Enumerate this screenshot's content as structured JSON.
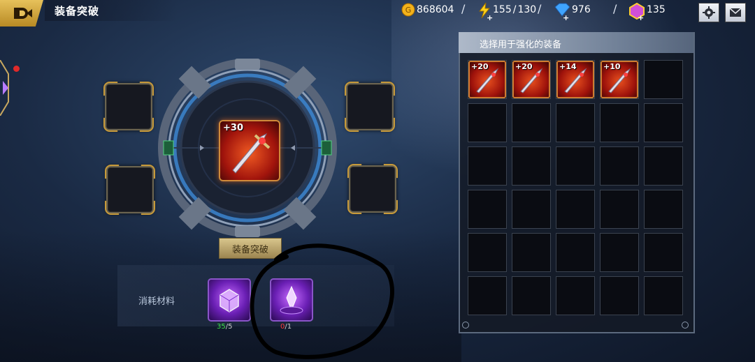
{
  "header": {
    "title": "装备突破"
  },
  "resources": {
    "gold": "868604",
    "energy": "155",
    "energy_max": "130",
    "diamond": "976",
    "gem": "135",
    "slash": "/"
  },
  "forge": {
    "center_item_level": "+30",
    "action_button": "装备突破",
    "materials_label": "消耗材料",
    "materials": [
      {
        "name": "cube-material",
        "have": "35",
        "need": "5",
        "have_color": "#3fe04a"
      },
      {
        "name": "crystal-material",
        "have": "0",
        "need": "1",
        "have_color": "#ff3a3a"
      }
    ]
  },
  "inventory": {
    "title": "选择用于强化的装备",
    "items": [
      {
        "level": "+20"
      },
      {
        "level": "+20"
      },
      {
        "level": "+14"
      },
      {
        "level": "+10"
      }
    ]
  },
  "colors": {
    "gold_accent": "#c79a3a",
    "annotation_ink": "#000000"
  }
}
